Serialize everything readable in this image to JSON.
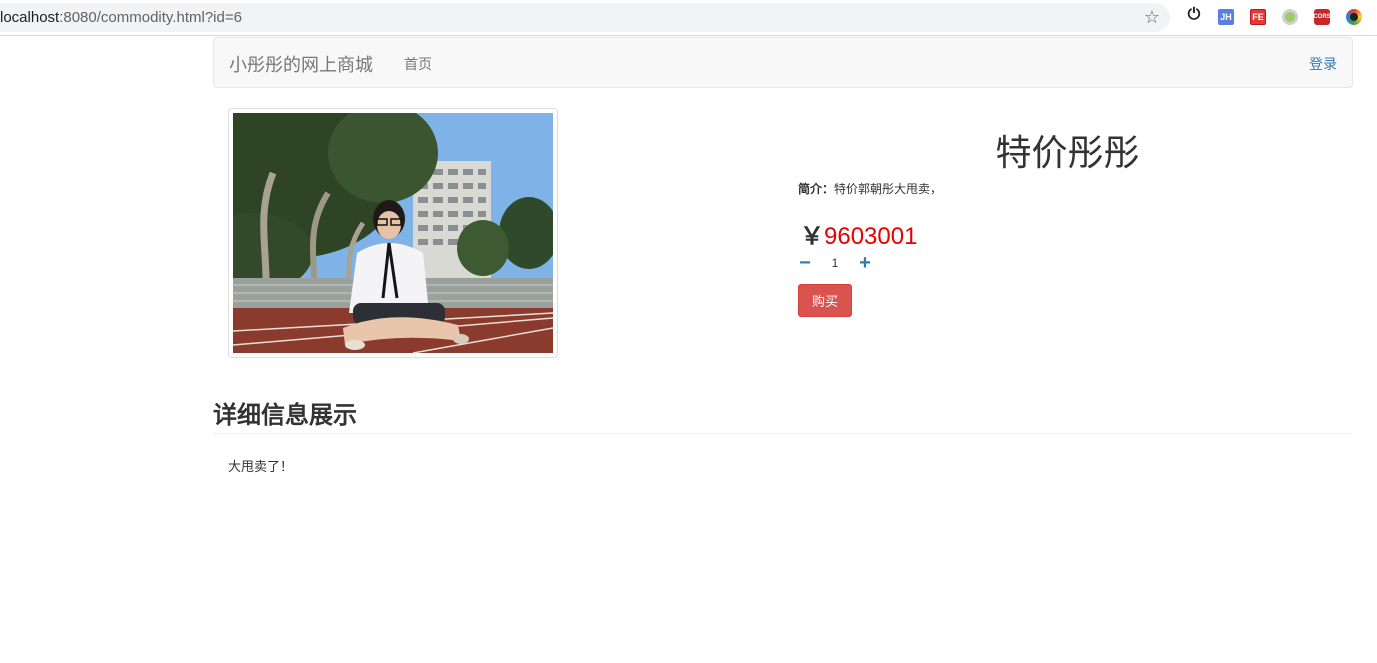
{
  "browser": {
    "url_host": "localhost",
    "url_rest": ":8080/commodity.html?id=6",
    "icons": [
      "bookmark-star-icon",
      "power-icon",
      "jh-extension-icon",
      "fe-extension-icon",
      "green-dot-extension-icon",
      "cors-extension-icon",
      "color-picker-extension-icon"
    ],
    "ext_labels": {
      "jh": "JH",
      "fe": "FE",
      "cors": "CORS"
    }
  },
  "navbar": {
    "brand": "小彤彤的网上商城",
    "home": "首页",
    "login": "登录"
  },
  "product": {
    "name": "特价彤彤",
    "intro_label": "简介：",
    "intro_text": "特价郭朝彤大甩卖，",
    "currency": "￥",
    "price": "9603001",
    "quantity": "1",
    "buy_label": "购买"
  },
  "details": {
    "heading": "详细信息展示",
    "body": "大甩卖了！"
  },
  "colors": {
    "price": "#e60000",
    "buy_button": "#d9534f",
    "link": "#337ab7",
    "navbar_bg": "#f8f8f8"
  }
}
